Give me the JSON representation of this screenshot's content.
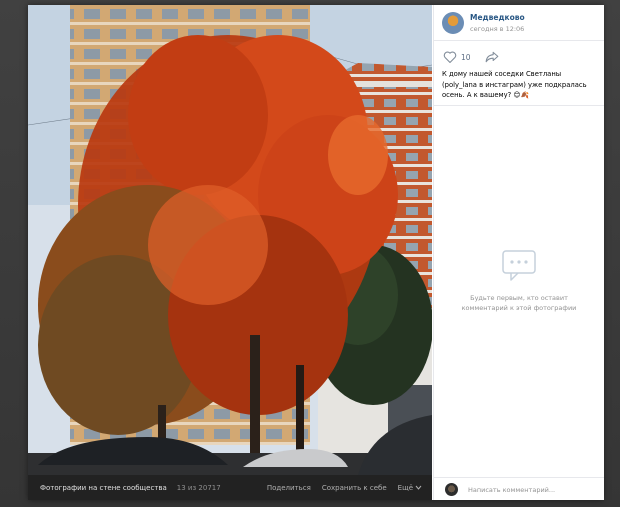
{
  "photo_bar": {
    "album_label": "Фотографии на стене сообщества",
    "counter": "13 из 20717",
    "share_label": "Поделиться",
    "save_label": "Сохранить к себе",
    "more_label": "Ещё"
  },
  "post": {
    "author": "Медведково",
    "time": "сегодня в 12:06",
    "likes": "10",
    "caption": "К дому нашей соседки Светланы (poly_lana в инстаграм) уже подкралась осень. А к вашему? 😊🍂"
  },
  "comments": {
    "empty_text": "Будьте первым, кто оставит комментарий к этой фотографии",
    "input_placeholder": "Написать комментарий..."
  },
  "colors": {
    "link": "#2a5885",
    "muted": "#939393",
    "photo_bar_bg": "#222222"
  }
}
